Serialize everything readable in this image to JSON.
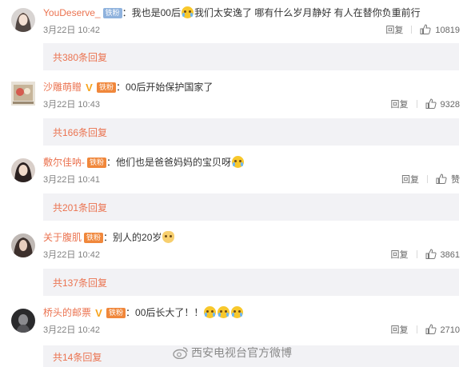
{
  "reply_label": "回复",
  "comments": [
    {
      "username": "YouDeserve_",
      "badges": [
        "铁粉"
      ],
      "text_parts": [
        "：我也是00后",
        "我们太安逸了 哪有什么岁月静好 有人在替你负重前行"
      ],
      "time": "3月22日 10:42",
      "likes": "10819",
      "more": "共380条回复",
      "avatar_icon": "avatar-girl"
    },
    {
      "username": "沙雕萌贈",
      "badges": [
        "V",
        "铁粉"
      ],
      "text_parts": [
        "：00后开始保护国家了"
      ],
      "time": "3月22日 10:43",
      "likes": "9328",
      "more": "共166条回复",
      "avatar_icon": "avatar-photo"
    },
    {
      "username": "敷尔佳呐-",
      "badges": [
        "铁粉"
      ],
      "text_parts": [
        "：他们也是爸爸妈妈的宝贝呀"
      ],
      "time": "3月22日 10:41",
      "likes": "赞",
      "more": "共201条回复",
      "avatar_icon": "avatar-girl"
    },
    {
      "username": "关于腹肌",
      "badges": [
        "铁粉"
      ],
      "text_parts": [
        "：别人的20岁"
      ],
      "time": "3月22日 10:42",
      "likes": "3861",
      "more": "共137条回复",
      "avatar_icon": "avatar-girl"
    },
    {
      "username": "桥头的邮票",
      "badges": [
        "V",
        "铁粉"
      ],
      "text_parts": [
        "：00后长大了！！"
      ],
      "time": "3月22日 10:42",
      "likes": "2710",
      "more": "共14条回复",
      "avatar_icon": "avatar-dark"
    }
  ],
  "watermark": "西安电视台官方微博",
  "colors": {
    "username": "#eb7350",
    "sub_bg": "#f2f2f5",
    "badge_blue": "#8fb2dd",
    "badge_orange": "#f0873b"
  }
}
